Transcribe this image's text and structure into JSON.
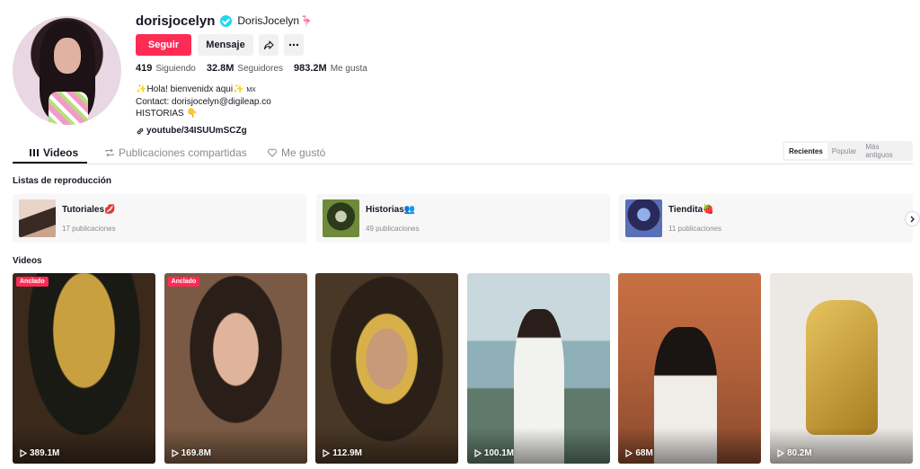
{
  "profile": {
    "username": "dorisjocelyn",
    "nickname": "DorisJocelyn",
    "follow_label": "Seguir",
    "message_label": "Mensaje",
    "stats": [
      {
        "value": "419",
        "label": "Siguiendo"
      },
      {
        "value": "32.8M",
        "label": "Seguidores"
      },
      {
        "value": "983.2M",
        "label": "Me gusta"
      }
    ],
    "bio_line1": "Hola! bienvenidx aqui",
    "bio_mx": "MX",
    "bio_line2": "Contact: dorisjocelyn@digileap.co",
    "bio_line3": "HISTORIAS",
    "link": "youtube/34ISUUmSCZg"
  },
  "tabs": [
    {
      "label": "Videos",
      "icon": "grid-icon"
    },
    {
      "label": "Publicaciones compartidas",
      "icon": "repost-icon"
    },
    {
      "label": "Me gustó",
      "icon": "heart-icon"
    }
  ],
  "sort": [
    "Recientes",
    "Popular",
    "Más antiguos"
  ],
  "playlists_title": "Listas de reproducción",
  "playlists": [
    {
      "title": "Tutoriales",
      "emoji": "💋",
      "count": "17 publicaciones",
      "thumb_color": "#c9a58f"
    },
    {
      "title": "Historias",
      "emoji": "👥",
      "count": "49 publicaciones",
      "thumb_color": "#6f8a3a"
    },
    {
      "title": "Tiendita",
      "emoji": "🍓",
      "count": "11 publicaciones",
      "thumb_color": "#5a6fb8"
    }
  ],
  "videos_title": "Videos",
  "pinned_label": "Anclado",
  "videos": [
    {
      "views": "389.1M",
      "pinned": true,
      "bg": "#3b2a1c",
      "accent": "#c9a040"
    },
    {
      "views": "169.8M",
      "pinned": true,
      "bg": "#7a5a44",
      "accent": "#d43a3a"
    },
    {
      "views": "112.9M",
      "pinned": false,
      "bg": "#4a3826",
      "accent": "#d8b04a"
    },
    {
      "views": "100.1M",
      "pinned": false,
      "bg": "#8fb0b8",
      "accent": "#f2f2ee"
    },
    {
      "views": "68M",
      "pinned": false,
      "bg": "#b0603a",
      "accent": "#f0ece8"
    },
    {
      "views": "80.2M",
      "pinned": false,
      "bg": "#ece9e4",
      "accent": "#c9a040"
    }
  ]
}
